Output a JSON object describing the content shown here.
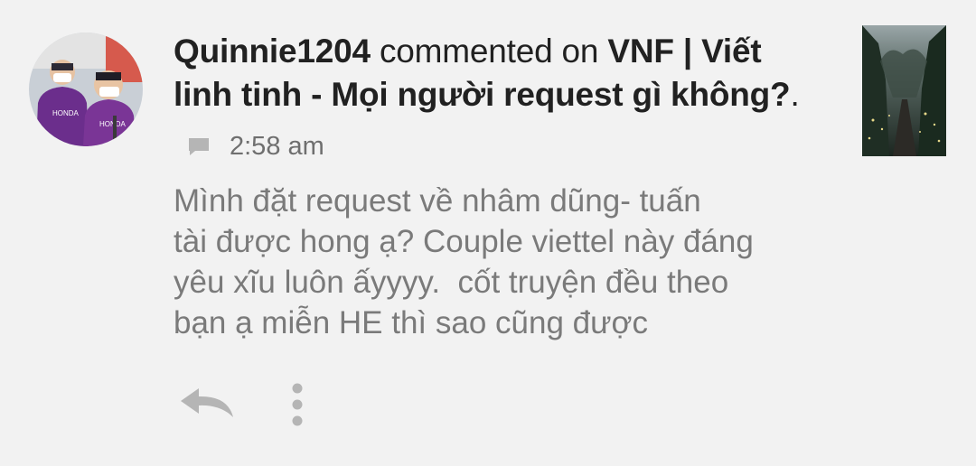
{
  "notification": {
    "username": "Quinnie1204",
    "action_text": "commented on",
    "story_title": "VNF | Viết linh tinh - Mọi người request gì không?",
    "title_suffix": ".",
    "time": "2:58 am",
    "comment_lines": [
      "Mình đặt request về nhâm dũng- tuấn",
      "tài được hong ạ? Couple viettel này đáng",
      "yêu xĩu luôn ấyyyy.  cốt truyện đều theo",
      "bạn ạ miễn HE thì sao cũng được"
    ],
    "avatar_icon": "user-avatar-photo",
    "thumbnail_icon": "story-cover-forest-path",
    "comment_icon": "comment-bubble-icon",
    "reply_icon": "reply-arrow-icon",
    "more_icon": "vertical-dots-icon"
  },
  "colors": {
    "background": "#f2f2f2",
    "headline": "#212121",
    "meta": "#6f6f6f",
    "body": "#7a7a7a",
    "icon": "#b5b5b5"
  }
}
